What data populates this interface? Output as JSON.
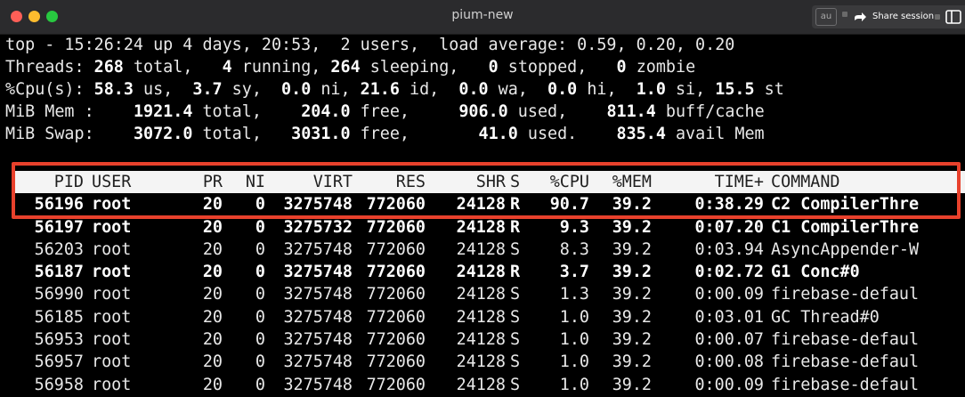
{
  "window": {
    "title": "pium-new",
    "tools": {
      "au_label": "au",
      "share_label": "Share session",
      "share_icon": "share-arrow-icon",
      "sidebar_icon": "sidebar-toggle-icon"
    }
  },
  "summary": {
    "line1": {
      "text": "top - 15:26:24 up 4 days, 20:53,  2 users,  load average: 0.59, 0.20, 0.20"
    },
    "threads": {
      "label": "Threads:",
      "total": "268",
      "total_label": "total,",
      "running": "4",
      "running_label": "running,",
      "sleeping": "264",
      "sleeping_label": "sleeping,",
      "stopped": "0",
      "stopped_label": "stopped,",
      "zombie": "0",
      "zombie_label": "zombie"
    },
    "cpu": {
      "label": "%Cpu(s):",
      "us": "58.3",
      "sy": "3.7",
      "ni": "0.0",
      "id": "21.6",
      "wa": "0.0",
      "hi": "0.0",
      "si": "1.0",
      "st": "15.5"
    },
    "mem": {
      "label": "MiB Mem :",
      "total": "1921.4",
      "free": "204.0",
      "used": "906.0",
      "buff_cache": "811.4"
    },
    "swap": {
      "label": "MiB Swap:",
      "total": "3072.0",
      "free": "3031.0",
      "used": "41.0",
      "avail": "835.4"
    }
  },
  "table": {
    "headers": {
      "pid": "PID",
      "user": "USER",
      "pr": "PR",
      "ni": "NI",
      "virt": "VIRT",
      "res": "RES",
      "shr": "SHR",
      "s": "S",
      "cpu": "%CPU",
      "mem": "%MEM",
      "time": "TIME+",
      "command": "COMMAND"
    },
    "rows": [
      {
        "pid": "56196",
        "user": "root",
        "pr": "20",
        "ni": "0",
        "virt": "3275748",
        "res": "772060",
        "shr": "24128",
        "s": "R",
        "cpu": "90.7",
        "mem": "39.2",
        "time": "0:38.29",
        "command": "C2 CompilerThre",
        "bold": true
      },
      {
        "pid": "56197",
        "user": "root",
        "pr": "20",
        "ni": "0",
        "virt": "3275732",
        "res": "772060",
        "shr": "24128",
        "s": "R",
        "cpu": "9.3",
        "mem": "39.2",
        "time": "0:07.20",
        "command": "C1 CompilerThre",
        "bold": true
      },
      {
        "pid": "56203",
        "user": "root",
        "pr": "20",
        "ni": "0",
        "virt": "3275748",
        "res": "772060",
        "shr": "24128",
        "s": "S",
        "cpu": "8.3",
        "mem": "39.2",
        "time": "0:03.94",
        "command": "AsyncAppender-W",
        "bold": false
      },
      {
        "pid": "56187",
        "user": "root",
        "pr": "20",
        "ni": "0",
        "virt": "3275748",
        "res": "772060",
        "shr": "24128",
        "s": "R",
        "cpu": "3.7",
        "mem": "39.2",
        "time": "0:02.72",
        "command": "G1 Conc#0",
        "bold": true
      },
      {
        "pid": "56990",
        "user": "root",
        "pr": "20",
        "ni": "0",
        "virt": "3275748",
        "res": "772060",
        "shr": "24128",
        "s": "S",
        "cpu": "1.3",
        "mem": "39.2",
        "time": "0:00.09",
        "command": "firebase-defaul",
        "bold": false
      },
      {
        "pid": "56185",
        "user": "root",
        "pr": "20",
        "ni": "0",
        "virt": "3275748",
        "res": "772060",
        "shr": "24128",
        "s": "S",
        "cpu": "1.0",
        "mem": "39.2",
        "time": "0:03.01",
        "command": "GC Thread#0",
        "bold": false
      },
      {
        "pid": "56953",
        "user": "root",
        "pr": "20",
        "ni": "0",
        "virt": "3275748",
        "res": "772060",
        "shr": "24128",
        "s": "S",
        "cpu": "1.0",
        "mem": "39.2",
        "time": "0:00.07",
        "command": "firebase-defaul",
        "bold": false
      },
      {
        "pid": "56957",
        "user": "root",
        "pr": "20",
        "ni": "0",
        "virt": "3275748",
        "res": "772060",
        "shr": "24128",
        "s": "S",
        "cpu": "1.0",
        "mem": "39.2",
        "time": "0:00.08",
        "command": "firebase-defaul",
        "bold": false
      },
      {
        "pid": "56958",
        "user": "root",
        "pr": "20",
        "ni": "0",
        "virt": "3275748",
        "res": "772060",
        "shr": "24128",
        "s": "S",
        "cpu": "1.0",
        "mem": "39.2",
        "time": "0:00.09",
        "command": "firebase-defaul",
        "bold": false
      }
    ]
  },
  "colors": {
    "highlight_border": "#e8412c",
    "terminal_bg": "#000000",
    "header_row_bg": "#f4f4f4"
  }
}
